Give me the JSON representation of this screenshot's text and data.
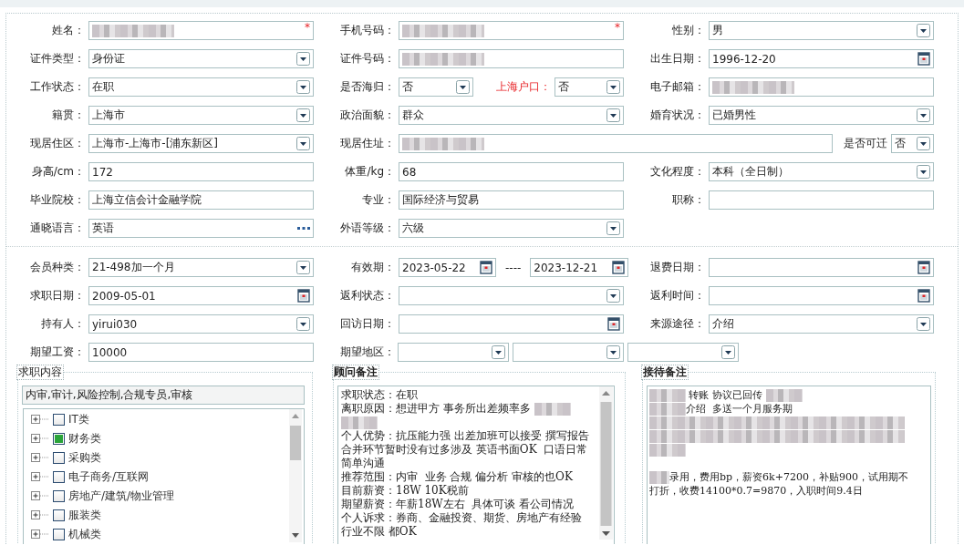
{
  "sections": [
    {
      "rows": [
        [
          {
            "fields": [
              {
                "label": "姓名：",
                "kind": "text",
                "redacted": true,
                "marker": "*"
              }
            ]
          },
          {
            "fields": [
              {
                "label": "手机号码：",
                "kind": "text",
                "redacted": true,
                "marker": "*"
              }
            ]
          },
          {
            "fields": [
              {
                "label": "性别：",
                "kind": "select",
                "value": "男"
              }
            ]
          }
        ],
        [
          {
            "fields": [
              {
                "label": "证件类型：",
                "kind": "select",
                "value": "身份证"
              }
            ]
          },
          {
            "fields": [
              {
                "label": "证件号码：",
                "kind": "text",
                "redacted": true
              }
            ]
          },
          {
            "fields": [
              {
                "label": "出生日期：",
                "kind": "date",
                "value": "1996-12-20"
              }
            ]
          }
        ],
        [
          {
            "fields": [
              {
                "label": "工作状态：",
                "kind": "select",
                "value": "在职"
              }
            ]
          },
          {
            "fields": [
              {
                "label": "是否海归：",
                "kind": "select",
                "value": "否"
              },
              {
                "label": "上海户口：",
                "kind": "select",
                "value": "否",
                "highlight": true
              }
            ]
          },
          {
            "fields": [
              {
                "label": "电子邮箱：",
                "kind": "text",
                "redacted": true
              }
            ]
          }
        ],
        [
          {
            "fields": [
              {
                "label": "籍贯：",
                "kind": "select",
                "value": "上海市"
              }
            ]
          },
          {
            "fields": [
              {
                "label": "政治面貌：",
                "kind": "select",
                "value": "群众"
              }
            ]
          },
          {
            "fields": [
              {
                "label": "婚育状况：",
                "kind": "select",
                "value": "已婚男性"
              }
            ]
          }
        ],
        [
          {
            "fields": [
              {
                "label": "现居住区：",
                "kind": "select",
                "value": "上海市-上海市-[浦东新区]"
              }
            ]
          },
          {
            "fields": [
              {
                "label": "现居住址：",
                "kind": "text",
                "redacted": true
              },
              {
                "label": "是否可迁",
                "kind": "select",
                "value": "否"
              }
            ]
          }
        ],
        [
          {
            "fields": [
              {
                "label": "身高/cm：",
                "kind": "text",
                "value": "172"
              }
            ]
          },
          {
            "fields": [
              {
                "label": "体重/kg：",
                "kind": "text",
                "value": "68"
              }
            ]
          },
          {
            "fields": [
              {
                "label": "文化程度：",
                "kind": "select",
                "value": "本科（全日制）"
              }
            ]
          }
        ],
        [
          {
            "fields": [
              {
                "label": "毕业院校：",
                "kind": "text",
                "value": "上海立信会计金融学院"
              }
            ]
          },
          {
            "fields": [
              {
                "label": "专业：",
                "kind": "text",
                "value": "国际经济与贸易"
              }
            ]
          },
          {
            "fields": [
              {
                "label": "职称：",
                "kind": "text"
              }
            ]
          }
        ],
        [
          {
            "fields": [
              {
                "label": "通晓语言：",
                "kind": "lookup",
                "value": "英语"
              }
            ]
          },
          {
            "fields": [
              {
                "label": "外语等级：",
                "kind": "select",
                "value": "六级"
              }
            ]
          }
        ]
      ]
    },
    {
      "rows": [
        [
          {
            "fields": [
              {
                "label": "会员种类：",
                "kind": "select",
                "value": "21-498加一个月"
              }
            ]
          },
          {
            "fields": [
              {
                "label": "有效期：",
                "kind": "daterange",
                "from": "2023-05-22",
                "separator": "----",
                "to": "2023-12-21"
              }
            ]
          },
          {
            "fields": [
              {
                "label": "退费日期：",
                "kind": "date"
              }
            ]
          }
        ],
        [
          {
            "fields": [
              {
                "label": "求职日期：",
                "kind": "date",
                "value": "2009-05-01"
              }
            ]
          },
          {
            "fields": [
              {
                "label": "返利状态：",
                "kind": "select"
              }
            ]
          },
          {
            "fields": [
              {
                "label": "返利时间：",
                "kind": "date"
              }
            ]
          }
        ],
        [
          {
            "fields": [
              {
                "label": "持有人：",
                "kind": "select",
                "value": "yirui030"
              }
            ]
          },
          {
            "fields": [
              {
                "label": "回访日期：",
                "kind": "date"
              }
            ]
          },
          {
            "fields": [
              {
                "label": "来源途径：",
                "kind": "select",
                "value": "介绍"
              }
            ]
          }
        ],
        [
          {
            "fields": [
              {
                "label": "期望工资：",
                "kind": "text",
                "value": "10000"
              }
            ]
          },
          {
            "fields": [
              {
                "label": "期望地区：",
                "kind": "select"
              },
              {
                "kind": "select"
              },
              {
                "kind": "select"
              }
            ]
          }
        ]
      ]
    }
  ],
  "panels": [
    {
      "kind": "tree",
      "title": "求职内容",
      "summary": "内审,审计,风险控制,合规专员,审核",
      "items": [
        {
          "label": "IT类",
          "expanded": false,
          "checked": false
        },
        {
          "label": "财务类",
          "expanded": false,
          "checked": true
        },
        {
          "label": "采购类",
          "expanded": false,
          "checked": false
        },
        {
          "label": "电子商务/互联网",
          "expanded": false,
          "checked": false
        },
        {
          "label": "房地产/建筑/物业管理",
          "expanded": false,
          "checked": false
        },
        {
          "label": "服装类",
          "expanded": false,
          "checked": false
        },
        {
          "label": "机械类",
          "expanded": false,
          "checked": false
        }
      ]
    },
    {
      "kind": "notes",
      "title": "顾问备注",
      "bold_title": true,
      "scrollbar": true,
      "lines": [
        [
          {
            "text": "求职状态：在职"
          }
        ],
        [
          {
            "text": "离职原因：想进甲方 事务所出差频率多 "
          },
          {
            "kind": "redacted"
          }
        ],
        [
          {
            "kind": "redacted"
          }
        ],
        [
          {
            "text": "个人优势：抗压能力强 出差加班可以接受 撰写报告"
          }
        ],
        [
          {
            "text": "合并环节暂时没有过多涉及 英语书面OK  口语日常"
          }
        ],
        [
          {
            "text": "简单沟通"
          }
        ],
        [
          {
            "text": "推荐范围：内审  业务 合规 偏分析 审核的也OK"
          }
        ],
        [
          {
            "text": "目前薪资：18W 10K税前"
          }
        ],
        [
          {
            "text": "期望薪资：年薪18W左右  具体可谈 看公司情况"
          }
        ],
        [
          {
            "text": "个人诉求：券商、金融投资、期货、房地产有经验"
          }
        ],
        [
          {
            "text": "行业不限 都OK"
          }
        ]
      ]
    },
    {
      "kind": "notes",
      "title": "接待备注",
      "bold_title": true,
      "scrollbar": false,
      "lines": [
        [
          {
            "kind": "redacted"
          },
          {
            "text": " 转账 协议已回传 "
          },
          {
            "kind": "redacted"
          }
        ],
        [
          {
            "kind": "redacted"
          },
          {
            "text": "介绍  多送一个月服务期"
          }
        ],
        [
          {
            "kind": "redacted",
            "full": true
          }
        ],
        [
          {
            "kind": "redacted",
            "full": true
          }
        ],
        [
          {
            "kind": "redacted"
          }
        ],
        [
          {
            "kind": "redacted",
            "new_paragraph": true
          },
          {
            "text": "录用，费用bp，薪资6k+7200，补贴900，试用期不"
          }
        ],
        [
          {
            "text": "打折，收费14100*0.7=9870，入职时间9.4日"
          }
        ]
      ]
    }
  ]
}
